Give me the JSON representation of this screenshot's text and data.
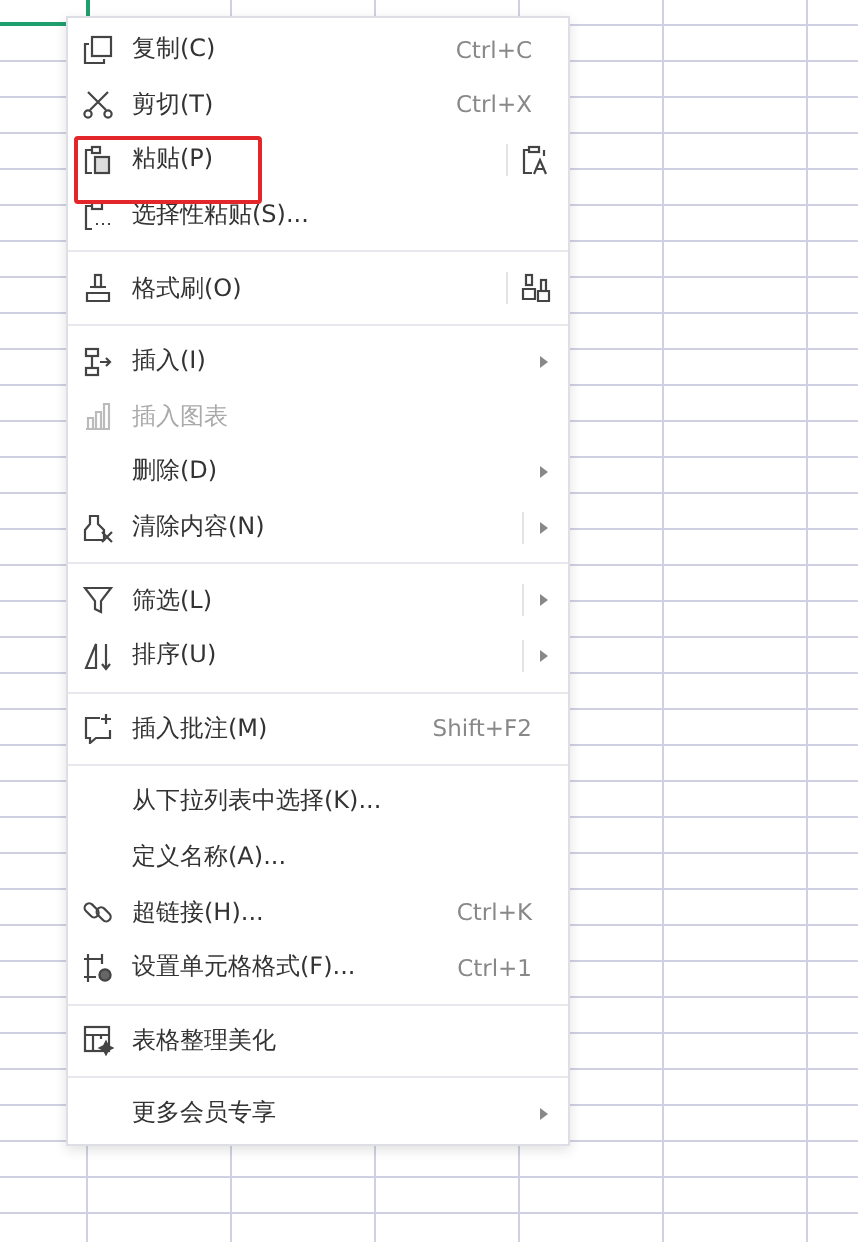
{
  "context_menu": {
    "groups": [
      [
        {
          "label": "复制(C)",
          "shortcut": "Ctrl+C",
          "disabled": false,
          "submenu": false,
          "split": false
        },
        {
          "label": "剪切(T)",
          "shortcut": "Ctrl+X",
          "disabled": false,
          "submenu": false,
          "split": false
        },
        {
          "label": "粘贴(P)",
          "disabled": false,
          "submenu": false,
          "split": true,
          "highlighted": true
        },
        {
          "label": "选择性粘贴(S)...",
          "disabled": false,
          "submenu": false,
          "split": false
        }
      ],
      [
        {
          "label": "格式刷(O)",
          "disabled": false,
          "submenu": false,
          "split": true
        }
      ],
      [
        {
          "label": "插入(I)",
          "disabled": false,
          "submenu": true,
          "split": false
        },
        {
          "label": "插入图表",
          "disabled": true,
          "submenu": false,
          "split": false
        },
        {
          "label": "删除(D)",
          "disabled": false,
          "submenu": true,
          "split": false
        },
        {
          "label": "清除内容(N)",
          "disabled": false,
          "submenu": true,
          "split": true
        }
      ],
      [
        {
          "label": "筛选(L)",
          "disabled": false,
          "submenu": true,
          "split": true
        },
        {
          "label": "排序(U)",
          "disabled": false,
          "submenu": true,
          "split": true
        }
      ],
      [
        {
          "label": "插入批注(M)",
          "shortcut": "Shift+F2",
          "disabled": false,
          "submenu": false,
          "split": false
        }
      ],
      [
        {
          "label": "从下拉列表中选择(K)...",
          "disabled": false,
          "submenu": false,
          "split": false
        },
        {
          "label": "定义名称(A)...",
          "disabled": false,
          "submenu": false,
          "split": false
        },
        {
          "label": "超链接(H)...",
          "shortcut": "Ctrl+K",
          "disabled": false,
          "submenu": false,
          "split": false
        },
        {
          "label": "设置单元格格式(F)...",
          "shortcut": "Ctrl+1",
          "disabled": false,
          "submenu": false,
          "split": false
        }
      ],
      [
        {
          "label": "表格整理美化",
          "disabled": false,
          "submenu": false,
          "split": false
        }
      ],
      [
        {
          "label": "更多会员专享",
          "disabled": false,
          "submenu": true,
          "split": false
        }
      ]
    ]
  }
}
